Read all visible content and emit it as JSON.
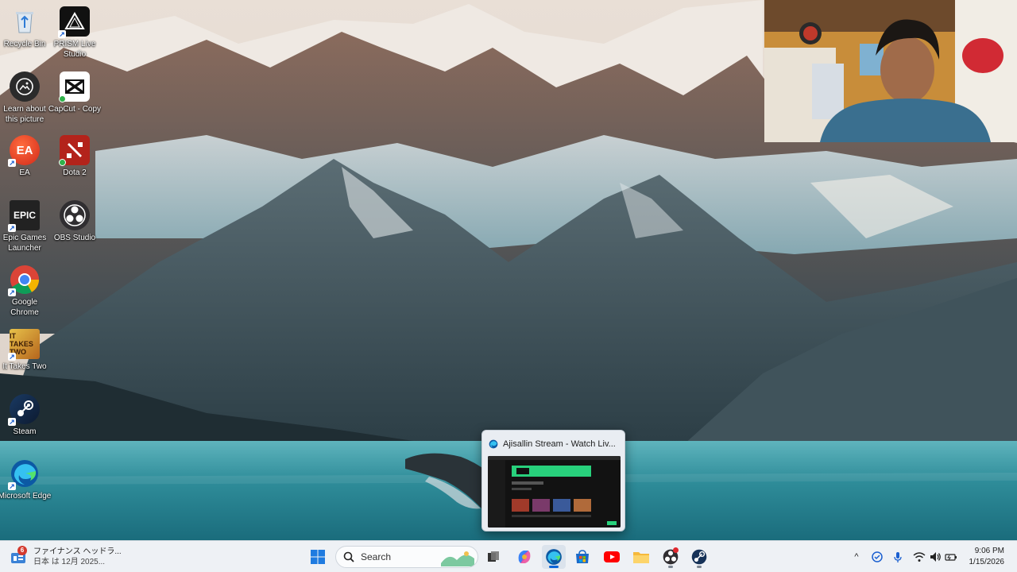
{
  "desktop": {
    "icons": [
      {
        "label": "Recycle Bin"
      },
      {
        "label": "PRISM Live Studio"
      },
      {
        "label": "Learn about this picture"
      },
      {
        "label": "CapCut - Copy"
      },
      {
        "label": "EA"
      },
      {
        "label": "Dota 2"
      },
      {
        "label": "Epic Games Launcher"
      },
      {
        "label": "OBS Studio"
      },
      {
        "label": "Google Chrome"
      },
      {
        "label": "It Takes Two"
      },
      {
        "label": "Steam"
      },
      {
        "label": "Microsoft Edge"
      }
    ]
  },
  "preview": {
    "title": "Ajisallin Stream - Watch Liv...",
    "icon": "edge-icon"
  },
  "taskbar": {
    "news": {
      "badge": "6",
      "line1": "ファイナンス ヘッドラ...",
      "line2": "日本 は 12月 2025..."
    },
    "search_placeholder": "Search",
    "apps": [
      "start-icon",
      "search-icon",
      "task-view-icon",
      "copilot-icon",
      "edge-icon",
      "store-icon",
      "youtube-icon",
      "file-explorer-icon",
      "obs-icon",
      "steam-icon"
    ],
    "tray": {
      "chevron": "^",
      "time": "9:06 PM",
      "date": "1/15/2026"
    }
  },
  "colors": {
    "taskbar": "#eef1f5",
    "accent": "#0a64d8"
  }
}
